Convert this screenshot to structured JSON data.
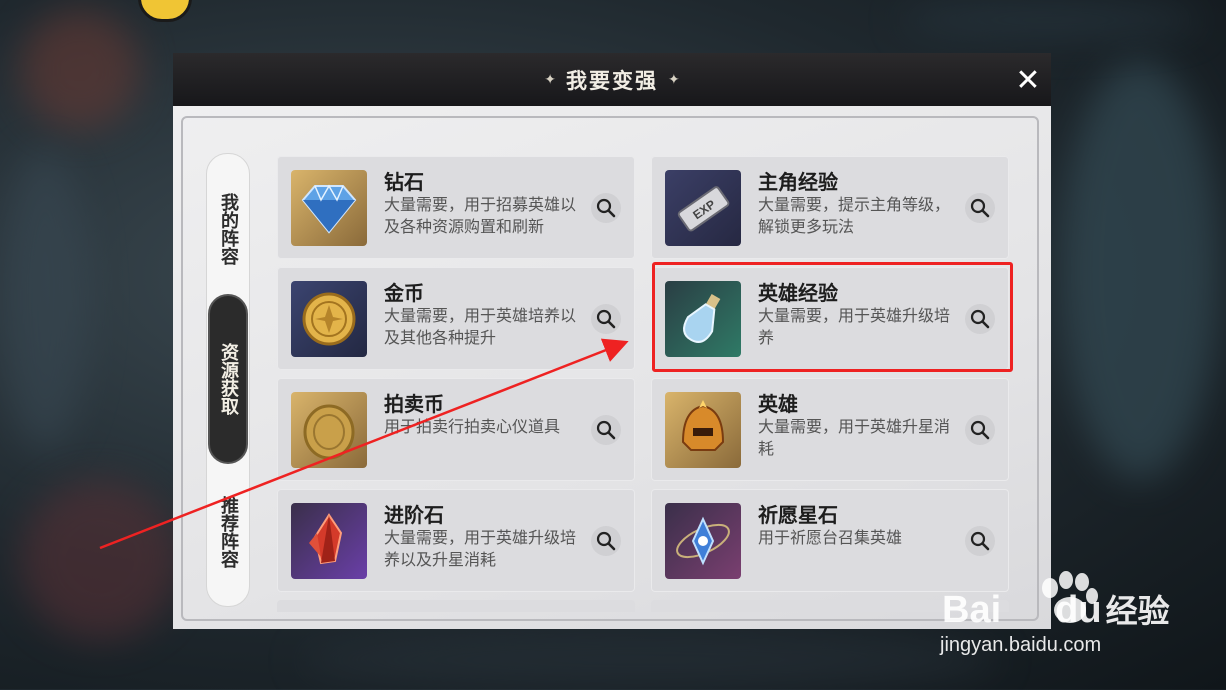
{
  "dialog": {
    "title": "我要变强",
    "title_deco": "✦",
    "close_label": "✕"
  },
  "tabs": [
    {
      "label": "我的阵容",
      "selected": false
    },
    {
      "label": "资源获取",
      "selected": true
    },
    {
      "label": "推荐阵容",
      "selected": false
    }
  ],
  "cards": [
    {
      "title": "钻石",
      "desc": "大量需要，用于招募英雄以及各种资源购置和刷新",
      "icon": "diamond-icon"
    },
    {
      "title": "主角经验",
      "desc": "大量需要，提示主角等级，解锁更多玩法",
      "icon": "exp-ticket-icon"
    },
    {
      "title": "金币",
      "desc": "大量需要，用于英雄培养以及其他各种提升",
      "icon": "gold-coin-icon"
    },
    {
      "title": "英雄经验",
      "desc": "大量需要，用于英雄升级培养",
      "icon": "potion-bottle-icon"
    },
    {
      "title": "拍卖币",
      "desc": "用于拍卖行拍卖心仪道具",
      "icon": "auction-coin-icon"
    },
    {
      "title": "英雄",
      "desc": "大量需要，用于英雄升星消耗",
      "icon": "helmet-icon"
    },
    {
      "title": "进阶石",
      "desc": "大量需要，用于英雄升级培养以及升星消耗",
      "icon": "red-crystal-icon"
    },
    {
      "title": "祈愿星石",
      "desc": "用于祈愿台召集英雄",
      "icon": "wish-star-icon"
    }
  ],
  "annotation": {
    "highlight_color": "#e22222"
  },
  "watermark": {
    "brand": "Bai",
    "brand2": "du",
    "suffix": "经验",
    "url": "jingyan.baidu.com"
  }
}
